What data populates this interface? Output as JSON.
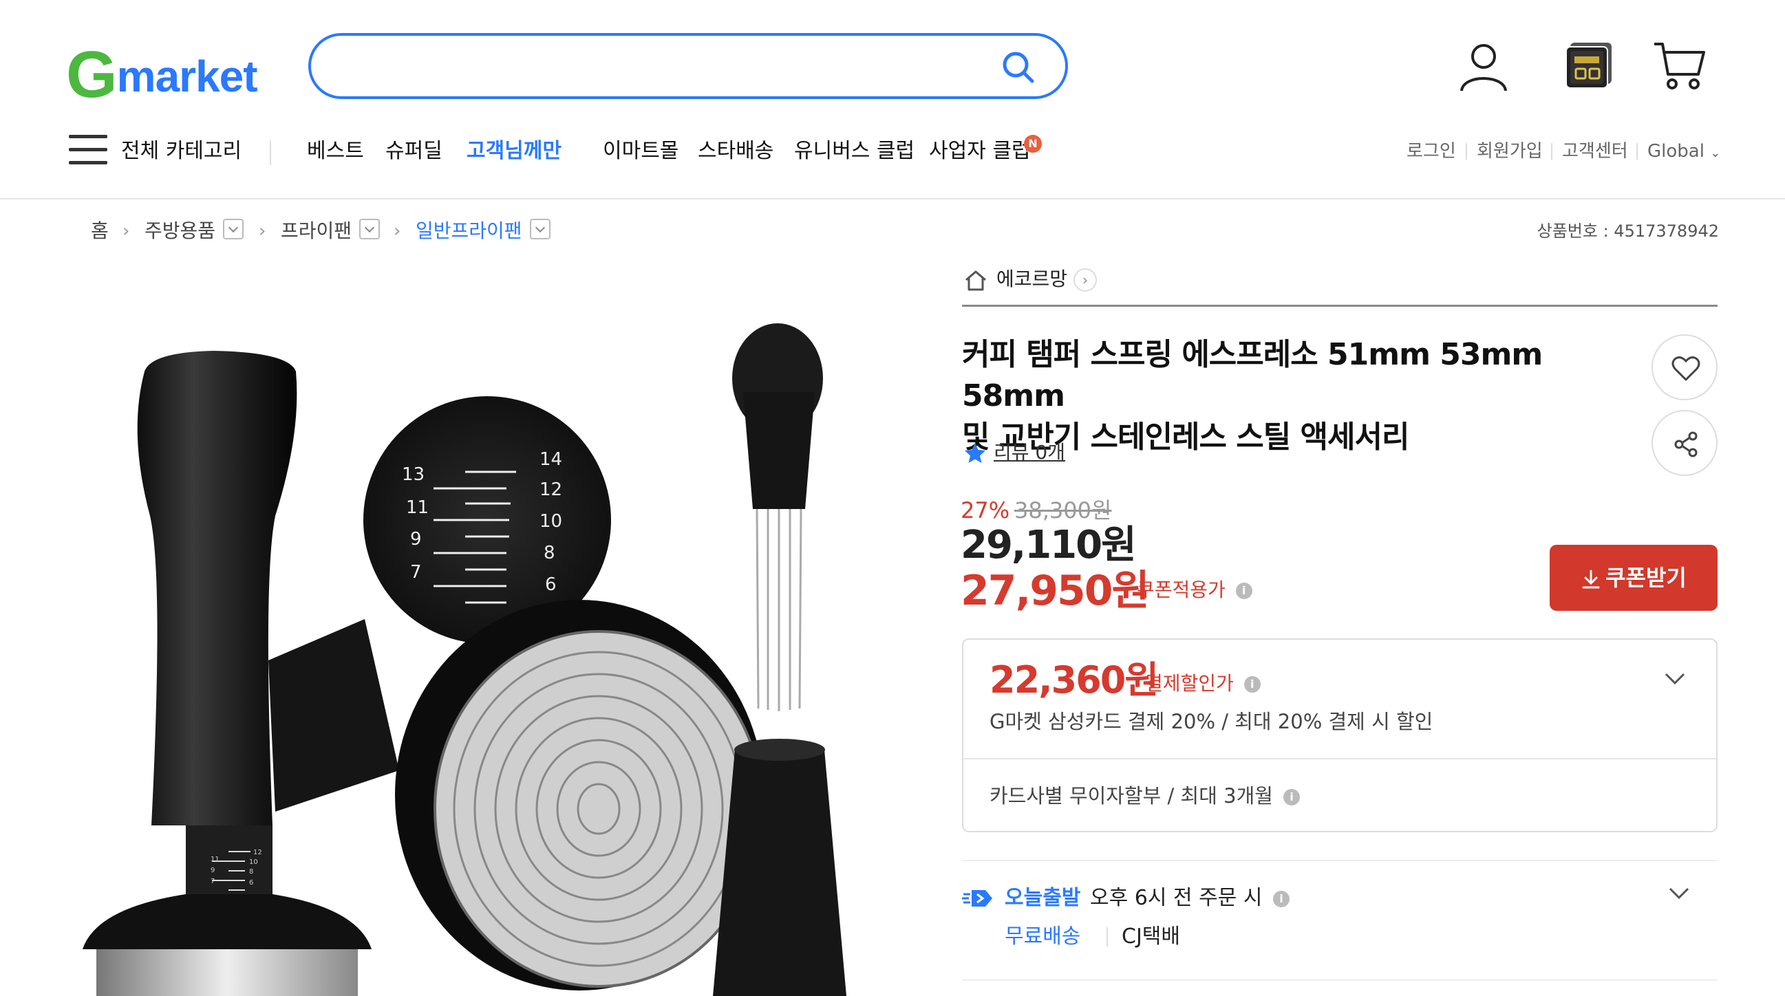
{
  "header": {
    "logo_g": "G",
    "logo_text": "market",
    "search": {
      "placeholder": "",
      "value": ""
    },
    "icons": [
      "user-icon",
      "recent-item-icon",
      "cart-icon"
    ]
  },
  "nav": {
    "all_categories": "전체 카테고리",
    "items": [
      "베스트",
      "슈퍼딜",
      "고객님께만",
      "이마트몰",
      "스타배송",
      "유니버스 클럽",
      "사업자 클럽"
    ],
    "highlight_item": "고객님께만",
    "new_badge": "N",
    "util": [
      "로그인",
      "회원가입",
      "고객센터",
      "Global"
    ]
  },
  "breadcrumb": {
    "items": [
      "홈",
      "주방용품",
      "프라이팬",
      "일반프라이팬"
    ],
    "product_no": "상품번호 : 4517378942"
  },
  "product": {
    "shop_name": "에코르망",
    "title_line1": "커피 탬퍼 스프링 에스프레소 51mm 53mm 58mm",
    "title_line2": "및 교반기 스테인레스 스틸 액세서리",
    "review_text": "리뷰 0개",
    "discount_rate": "27%",
    "original_price": "38,300원",
    "sale_price": "29,110원",
    "coupon_price": "27,950원",
    "coupon_label": "쿠폰적용가",
    "coupon_button": "쿠폰받기",
    "scale_left": [
      "13",
      "11",
      "9",
      "7"
    ],
    "scale_right": [
      "14",
      "12",
      "10",
      "8",
      "6"
    ],
    "small_scale_left": [
      "11",
      "9",
      "7"
    ],
    "small_scale_right": [
      "12",
      "10",
      "8",
      "6"
    ]
  },
  "payment": {
    "price": "22,360원",
    "label": "결제할인가",
    "desc": "G마켓 삼성카드 결제 20% / 최대 20% 결제 시 할인",
    "installment": "카드사별 무이자할부 / 최대 3개월"
  },
  "shipping": {
    "today_label": "오늘출발",
    "cutoff": "오후 6시 전 주문 시",
    "free": "무료배송",
    "carrier": "CJ택배"
  },
  "colors": {
    "brand_blue": "#2a79ff",
    "sale_red": "#d63a2e",
    "logo_green": "#4bb83f"
  }
}
